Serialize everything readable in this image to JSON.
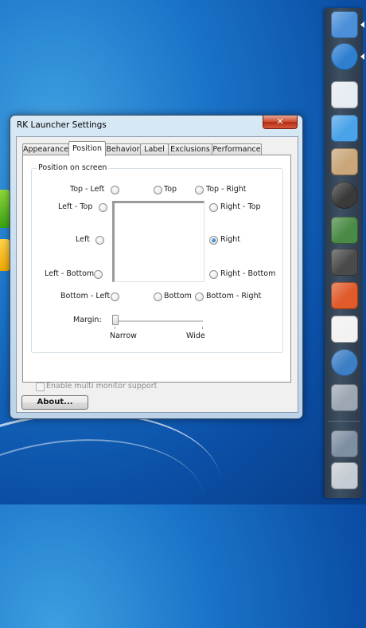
{
  "window": {
    "title": "RK Launcher Settings",
    "close_glyph": "✕"
  },
  "tabs": [
    {
      "label": "Appearance",
      "active": false
    },
    {
      "label": "Position",
      "active": true
    },
    {
      "label": "Behavior",
      "active": false
    },
    {
      "label": "Label",
      "active": false
    },
    {
      "label": "Exclusions",
      "active": false
    },
    {
      "label": "Performance",
      "active": false
    }
  ],
  "position": {
    "group_label": "Position on screen",
    "selected": "Right",
    "options": {
      "top_left": "Top - Left",
      "top": "Top",
      "top_right": "Top - Right",
      "left_top": "Left - Top",
      "right_top": "Right - Top",
      "left": "Left",
      "right": "Right",
      "left_bottom": "Left - Bottom",
      "right_bottom": "Right - Bottom",
      "bottom_left": "Bottom - Left",
      "bottom": "Bottom",
      "bottom_right": "Bottom - Right"
    }
  },
  "margin": {
    "label": "Margin:",
    "min_label": "Narrow",
    "max_label": "Wide",
    "value": 0
  },
  "multi_monitor": {
    "label": "Enable multi monitor support",
    "checked": false,
    "enabled": false
  },
  "about_button": "About...",
  "dock": {
    "items": [
      {
        "icon": "finder-icon",
        "color": "#4a8fd8"
      },
      {
        "icon": "safari-icon",
        "color": "#2f7fd1"
      },
      {
        "icon": "mail-icon",
        "color": "#e7ecf2"
      },
      {
        "icon": "ichat-icon",
        "color": "#4aa3e8"
      },
      {
        "icon": "address-book-icon",
        "color": "#c9a77a"
      },
      {
        "icon": "itunes-icon",
        "color": "#3a3a3a"
      },
      {
        "icon": "iphoto-icon",
        "color": "#4a8a46"
      },
      {
        "icon": "movie-icon",
        "color": "#4a4a4a"
      },
      {
        "icon": "powerpoint-icon",
        "color": "#e05a2a"
      },
      {
        "icon": "calendar-icon",
        "color": "#f2f2f2"
      },
      {
        "icon": "quicktime-icon",
        "color": "#3d7fc5"
      },
      {
        "icon": "utilities-icon",
        "color": "#9ca7b3"
      },
      {
        "icon": "desktop-icon",
        "color": "#7e8ea3"
      },
      {
        "icon": "trash-icon",
        "color": "#c5ccd3"
      }
    ]
  }
}
